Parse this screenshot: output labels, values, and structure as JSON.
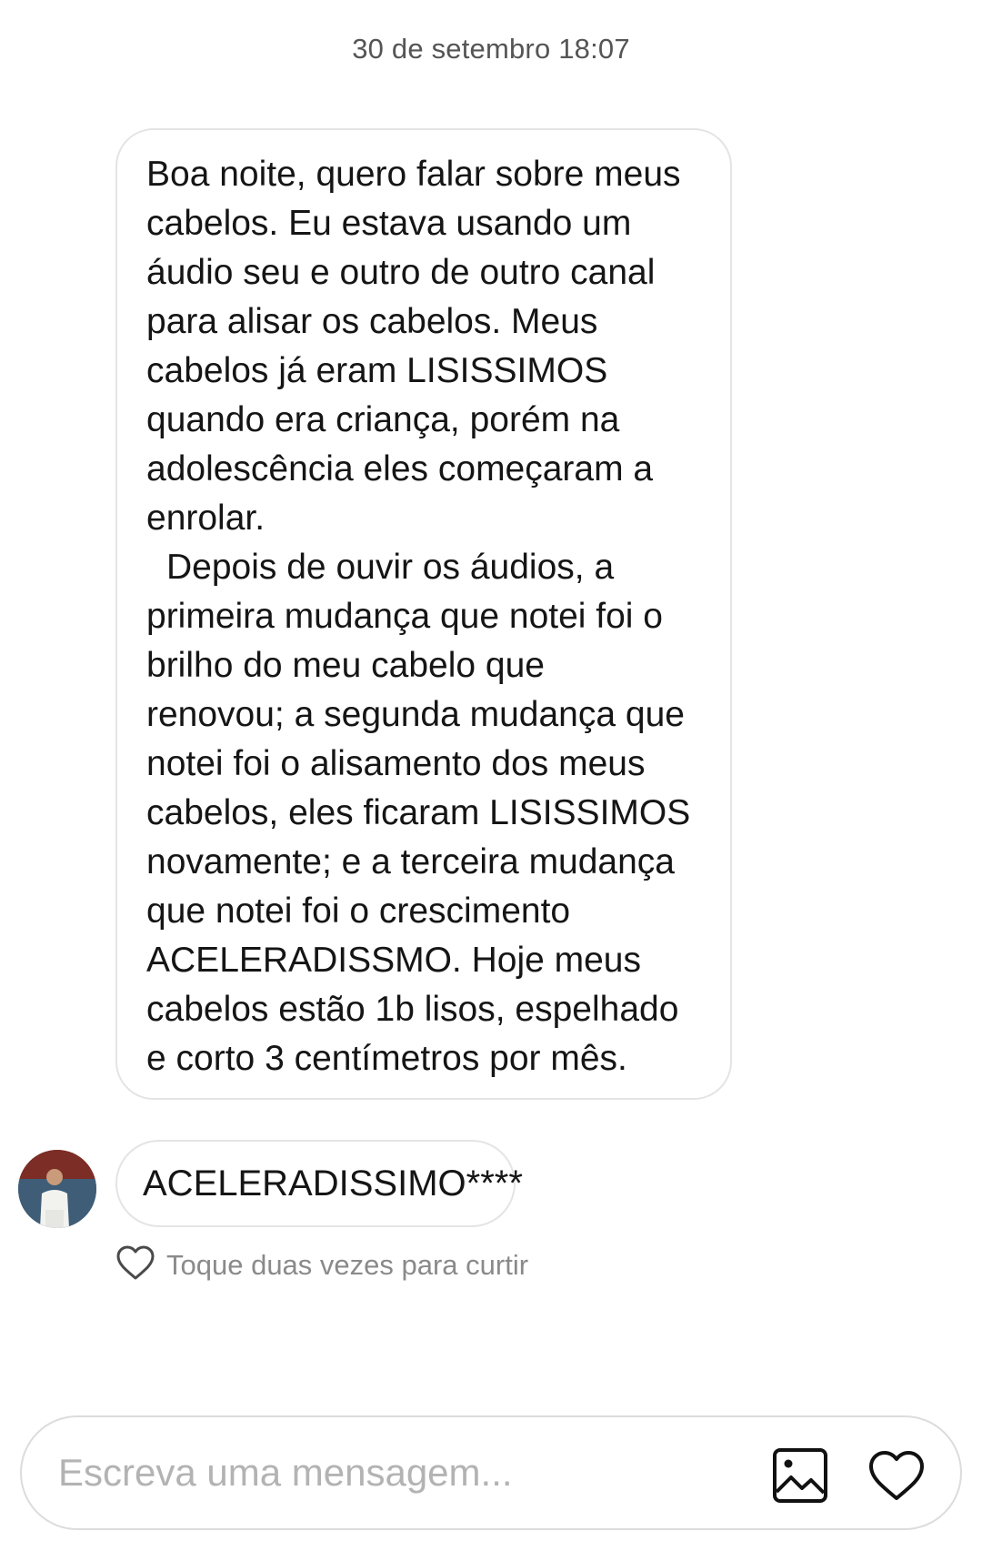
{
  "conversation": {
    "timestamp": "30 de setembro 18:07"
  },
  "messages": {
    "main": {
      "paragraphs": [
        "Boa noite, quero falar sobre meus\ncabelos. Eu estava usando um\náudio seu e outro de outro canal\npara alisar os cabelos. Meus\ncabelos já eram LISISSIMOS\nquando era criança, porém na\nadolescência eles começaram a\nenrolar.",
        "Depois de ouvir os áudios, a\nprimeira mudança que notei foi o\nbrilho do meu cabelo que\nrenovou; a segunda mudança que\nnotei foi o alisamento dos meus\ncabelos, eles ficaram LISISSIMOS\nnovamente; e a terceira mudança\nque notei foi o crescimento\nACELERADISSMO. Hoje meus\ncabelos estão 1b lisos, espelhado\ne corto 3 centímetros por mês."
      ]
    },
    "reply": {
      "text": "ACELERADISSIMO****"
    },
    "like_hint": "Toque duas vezes para curtir"
  },
  "composer": {
    "placeholder": "Escreva uma mensagem...",
    "value": "",
    "gallery_icon": "image-icon",
    "like_icon": "heart-icon"
  },
  "colors": {
    "background": "#ffffff",
    "bubble_border": "#e4e4e4",
    "text": "#151515",
    "muted": "#8a8a8a",
    "placeholder": "#b3b3b3"
  }
}
